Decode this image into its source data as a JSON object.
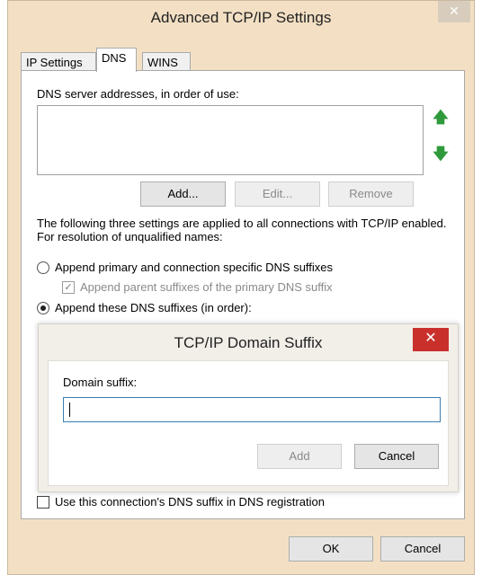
{
  "window": {
    "title": "Advanced TCP/IP Settings",
    "close_glyph": "✕"
  },
  "tabs": [
    {
      "label": "IP Settings"
    },
    {
      "label": "DNS"
    },
    {
      "label": "WINS"
    }
  ],
  "dns": {
    "servers_label": "DNS server addresses, in order of use:",
    "servers": [],
    "move_up_icon": "arrow-up",
    "move_down_icon": "arrow-down",
    "add_label": "Add...",
    "edit_label": "Edit...",
    "remove_label": "Remove",
    "info_text": "The following three settings are applied to all connections with TCP/IP enabled. For resolution of unqualified names:",
    "option_primary_label": "Append primary and connection specific DNS suffixes",
    "option_parent_label": "Append parent suffixes of the primary DNS suffix",
    "option_these_label": "Append these DNS suffixes (in order):",
    "register_label": "Use this connection's DNS suffix in DNS registration"
  },
  "dialog": {
    "title": "TCP/IP Domain Suffix",
    "close_glyph": "✕",
    "suffix_label": "Domain suffix:",
    "suffix_value": "",
    "add_label": "Add",
    "cancel_label": "Cancel"
  },
  "footer": {
    "ok_label": "OK",
    "cancel_label": "Cancel"
  },
  "colors": {
    "accent_arrow": "#2e9a3b",
    "close_red": "#c9302c",
    "focus_border": "#3c7fb1"
  }
}
